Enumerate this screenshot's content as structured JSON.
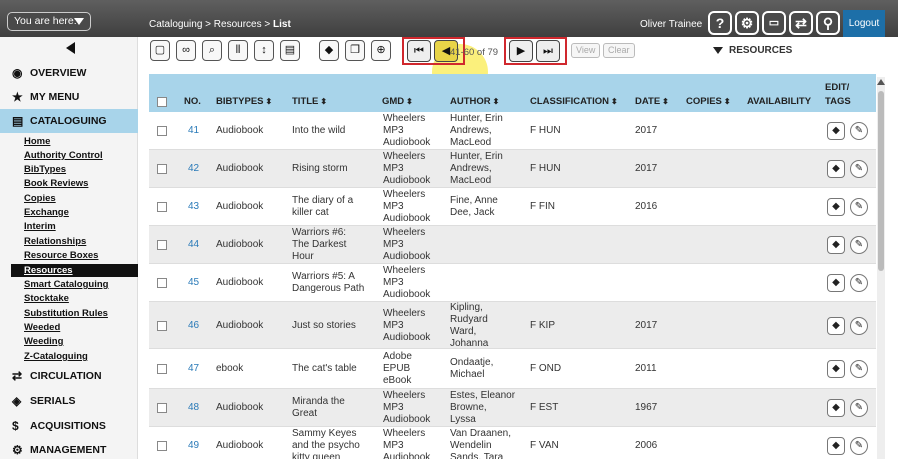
{
  "topbar": {
    "you_are_here": "You are here:",
    "breadcrumb": [
      "Cataloguing",
      "Resources",
      "List"
    ],
    "breadcrumb_sep": ">",
    "user": "Oliver Trainee",
    "logout": "Logout",
    "icons": [
      "help-icon",
      "settings-icon",
      "display-icon",
      "swap-icon",
      "search-icon"
    ]
  },
  "sidebar": {
    "main_items": [
      {
        "label": "Overview",
        "icon": "globe-icon",
        "underline_char": "O"
      },
      {
        "label": "My Menu",
        "icon": "star-icon"
      },
      {
        "label": "Cataloguing",
        "icon": "book-icon",
        "active": true
      },
      {
        "label": "Circulation",
        "icon": "exchange-icon"
      },
      {
        "label": "Serials",
        "icon": "tag-icon"
      },
      {
        "label": "Acquisitions",
        "icon": "dollar-icon"
      },
      {
        "label": "Management",
        "icon": "gear-icon"
      }
    ],
    "sub_items": [
      "Home",
      "Authority Control",
      "BibTypes",
      "Book Reviews",
      "Copies",
      "Exchange",
      "Interim",
      "Relationships",
      "Resource Boxes",
      "Resources",
      "Smart Cataloguing",
      "Stocktake",
      "Substitution Rules",
      "Weeded",
      "Weeding",
      "Z-Cataloguing"
    ],
    "active_sub": "Resources"
  },
  "toolbar": {
    "range_text": "41-60 of 79",
    "view_label": "View",
    "clear_label": "Clear",
    "resources_label": "RESOURCES"
  },
  "table": {
    "headers": {
      "no": "NO.",
      "bibtypes": "BIBTYPES",
      "title": "TITLE",
      "gmd": "GMD",
      "author": "AUTHOR",
      "classification": "CLASSIFICATION",
      "date": "DATE",
      "copies": "COPIES",
      "availability": "AVAILABILITY",
      "edit_tags_1": "EDIT/",
      "edit_tags_2": "TAGS"
    },
    "rows": [
      {
        "no": "41",
        "bibtype": "Audiobook",
        "title": [
          "Into the wild"
        ],
        "gmd": [
          "Wheelers",
          "MP3",
          "Audiobook"
        ],
        "author": [
          "Hunter, Erin",
          "Andrews,",
          "MacLeod"
        ],
        "classification": "F HUN",
        "date": "2017"
      },
      {
        "no": "42",
        "bibtype": "Audiobook",
        "title": [
          "Rising storm"
        ],
        "gmd": [
          "Wheelers",
          "MP3",
          "Audiobook"
        ],
        "author": [
          "Hunter, Erin",
          "Andrews,",
          "MacLeod"
        ],
        "classification": "F HUN",
        "date": "2017"
      },
      {
        "no": "43",
        "bibtype": "Audiobook",
        "title": [
          "The diary of a",
          "killer cat"
        ],
        "gmd": [
          "Wheelers",
          "MP3",
          "Audiobook"
        ],
        "author": [
          "Fine, Anne",
          "Dee, Jack"
        ],
        "classification": "F FIN",
        "date": "2016"
      },
      {
        "no": "44",
        "bibtype": "Audiobook",
        "title": [
          "Warriors #6:",
          "The Darkest",
          "Hour"
        ],
        "gmd": [
          "Wheelers",
          "MP3",
          "Audiobook"
        ],
        "author": [],
        "classification": "",
        "date": ""
      },
      {
        "no": "45",
        "bibtype": "Audiobook",
        "title": [
          "Warriors #5: A",
          "Dangerous Path"
        ],
        "gmd": [
          "Wheelers",
          "MP3",
          "Audiobook"
        ],
        "author": [],
        "classification": "",
        "date": ""
      },
      {
        "no": "46",
        "bibtype": "Audiobook",
        "title": [
          "Just so stories"
        ],
        "gmd": [
          "Wheelers",
          "MP3",
          "Audiobook"
        ],
        "author": [
          "Kipling,",
          "Rudyard",
          "Ward,",
          "Johanna"
        ],
        "classification": "F KIP",
        "date": "2017"
      },
      {
        "no": "47",
        "bibtype": "ebook",
        "title": [
          "The cat's table"
        ],
        "gmd": [
          "Adobe",
          "EPUB",
          "eBook"
        ],
        "author": [
          "Ondaatje,",
          "Michael"
        ],
        "classification": "F OND",
        "date": "2011"
      },
      {
        "no": "48",
        "bibtype": "Audiobook",
        "title": [
          "Miranda the",
          "Great"
        ],
        "gmd": [
          "Wheelers",
          "MP3",
          "Audiobook"
        ],
        "author": [
          "Estes, Eleanor",
          "Browne,",
          "Lyssa"
        ],
        "classification": "F EST",
        "date": "1967"
      },
      {
        "no": "49",
        "bibtype": "Audiobook",
        "title": [
          "Sammy Keyes",
          "and the psycho",
          "kitty queen"
        ],
        "gmd": [
          "Wheelers",
          "MP3",
          "Audiobook"
        ],
        "author": [
          "Van Draanen,",
          "Wendelin",
          "Sands, Tara"
        ],
        "classification": "F VAN",
        "date": "2006"
      }
    ]
  }
}
